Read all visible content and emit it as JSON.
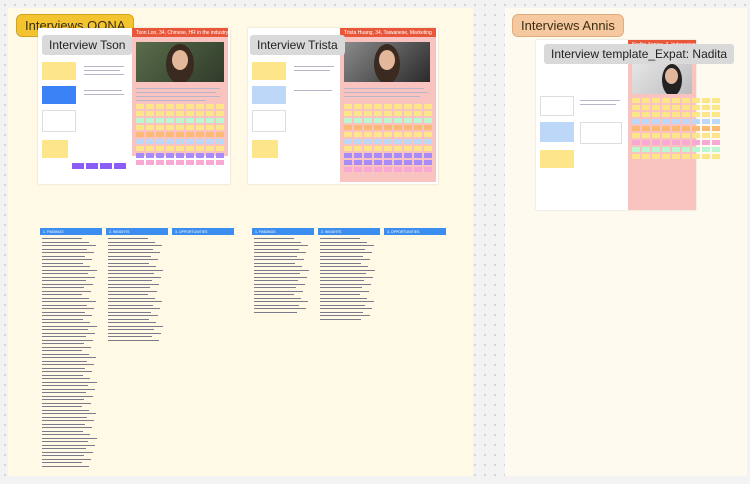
{
  "sections": {
    "oona": {
      "label": "Interviews OONA"
    },
    "annis": {
      "label": "Interviews Annis"
    }
  },
  "frames": {
    "tson": {
      "label": "Interview Tson",
      "header": "Tson Loo, 34, Chinese, HR in the industry"
    },
    "trista": {
      "label": "Interview Trista",
      "header": "Trista Huang, 34, Taiwanese, Marketing"
    },
    "nadita": {
      "label": "Interview template_Expat: Nadita",
      "header": "Nadita Annisa, 3, Indonesian, UX Design"
    }
  },
  "notes": {
    "tson": [
      "1. FINDINGS",
      "2. INSIGHTS",
      "3. OPPORTUNITIES"
    ],
    "trista": [
      "1. FINDINGS",
      "2. INSIGHTS",
      "3. OPPORTUNITIES"
    ]
  },
  "colors": {
    "yellow": "#fde68a",
    "blue": "#bcd7f7",
    "purple": "#a78bfa",
    "orange": "#fdba74",
    "pink": "#f9a8d4",
    "green": "#bbf7d0"
  }
}
